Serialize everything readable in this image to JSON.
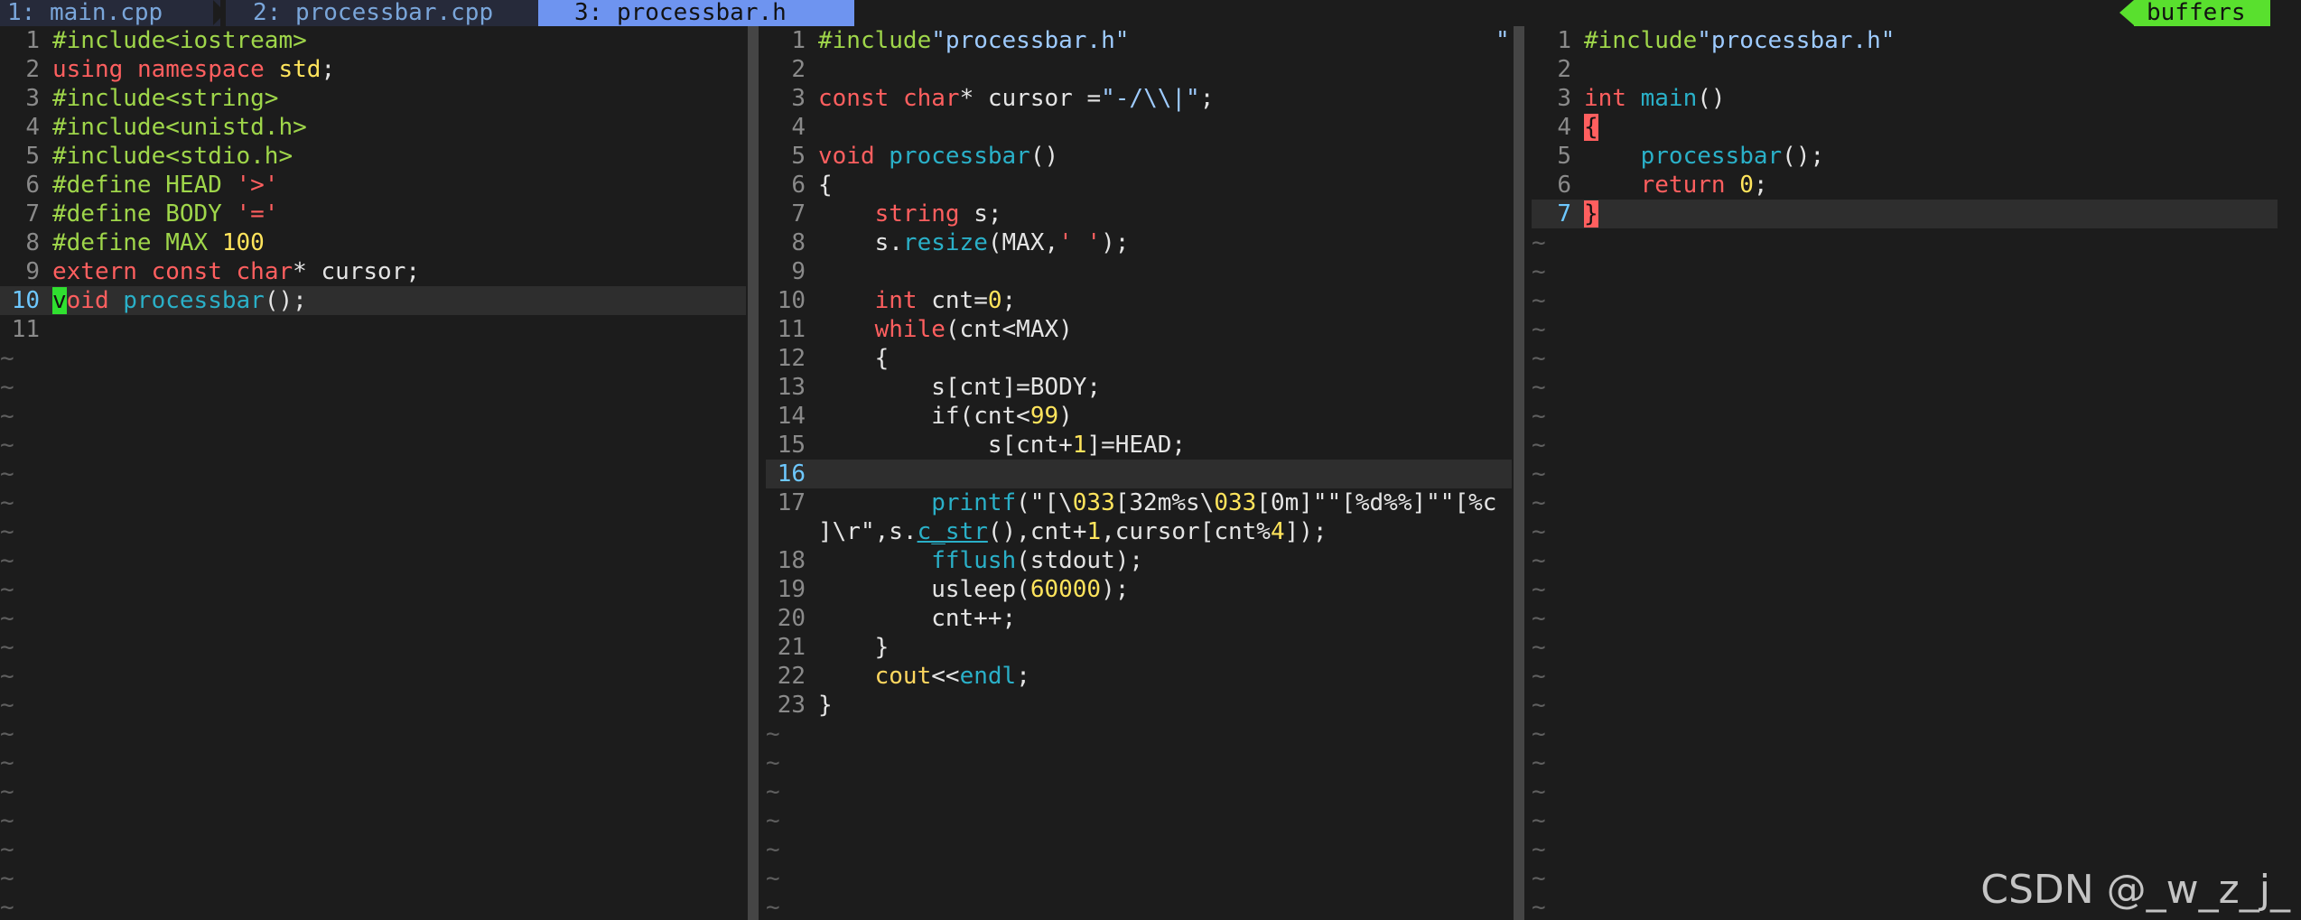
{
  "tabline": {
    "tabs": [
      {
        "label": "1: main.cpp",
        "active": false
      },
      {
        "label": "2: processbar.cpp",
        "active": false
      },
      {
        "label": "3: processbar.h",
        "active": true
      }
    ],
    "buffers_label": "buffers"
  },
  "panes": {
    "left": {
      "lines": [
        {
          "n": "1",
          "html": "<span class='pp'>#include&lt;iostream&gt;</span>"
        },
        {
          "n": "2",
          "html": "<span class='kw'>using</span> <span class='kw'>namespace</span> <span class='nm'>std</span>;"
        },
        {
          "n": "3",
          "html": "<span class='pp'>#include&lt;string&gt;</span>"
        },
        {
          "n": "4",
          "html": "<span class='pp'>#include&lt;unistd.h&gt;</span>"
        },
        {
          "n": "5",
          "html": "<span class='pp'>#include&lt;stdio.h&gt;</span>"
        },
        {
          "n": "6",
          "html": "<span class='pp'>#define HEAD </span><span class='kw'>'&gt;'</span>"
        },
        {
          "n": "7",
          "html": "<span class='pp'>#define BODY </span><span class='kw'>'='</span>"
        },
        {
          "n": "8",
          "html": "<span class='pp'>#define MAX </span><span class='nm'>100</span>"
        },
        {
          "n": "9",
          "html": "<span class='kw'>extern</span> <span class='kw'>const</span> <span class='ty'>char</span>* cursor;"
        },
        {
          "n": "10",
          "html": "<span class='cur-block'>v</span><span class='ty'>oid</span> <span class='fn'>processbar</span>();",
          "current": true
        },
        {
          "n": "11",
          "html": ""
        }
      ],
      "tilde_count": 20
    },
    "middle": {
      "lines": [
        {
          "n": "1",
          "html": "<span class='pp'>#include</span><span class='st'>\"processbar.h\"</span>"
        },
        {
          "n": "2",
          "html": ""
        },
        {
          "n": "3",
          "html": "<span class='kw'>const</span> <span class='ty'>char</span>* cursor =<span class='st'>\"-/\\\\|\"</span>;"
        },
        {
          "n": "4",
          "html": ""
        },
        {
          "n": "5",
          "html": "<span class='ty'>void</span> <span class='fn'>processbar</span>()"
        },
        {
          "n": "6",
          "html": "{"
        },
        {
          "n": "7",
          "html": "    <span class='ty'>string</span> s;"
        },
        {
          "n": "8",
          "html": "    s.<span class='fn'>resize</span>(MAX,<span class='kw'>' '</span>);"
        },
        {
          "n": "9",
          "html": ""
        },
        {
          "n": "10",
          "html": "    <span class='ty'>int</span> cnt=<span class='nm'>0</span>;"
        },
        {
          "n": "11",
          "html": "    <span class='kw'>while</span>(cnt&lt;MAX)"
        },
        {
          "n": "12",
          "html": "    {"
        },
        {
          "n": "13",
          "html": "        s[cnt]=BODY;"
        },
        {
          "n": "14",
          "html": "        <span class='id'>if</span>(cnt&lt;<span class='nm'>99</span>)"
        },
        {
          "n": "15",
          "html": "            s[cnt+<span class='nm'>1</span>]=HEAD;"
        },
        {
          "n": "16",
          "html": "",
          "current": true
        },
        {
          "n": "17",
          "html": "        <span class='fn'>printf</span>(\"[\\<span class='nm'>033</span>[32m%s\\<span class='nm'>033</span>[0m]\"\"[%d%%]\"\"[%c"
        },
        {
          "n": "",
          "html": "]\\r\",s.<span class='fn' style='text-decoration:underline'>c_str</span>(),cnt+<span class='nm'>1</span>,cursor[cnt%<span class='nm'>4</span>]);"
        },
        {
          "n": "18",
          "html": "        <span class='fn'>fflush</span>(stdout);"
        },
        {
          "n": "19",
          "html": "        usleep(<span class='nm'>60000</span>);"
        },
        {
          "n": "20",
          "html": "        cnt++;"
        },
        {
          "n": "21",
          "html": "    }"
        },
        {
          "n": "22",
          "html": "    <span class='hi-y'>cout</span>&lt;&lt;<span class='fn'>endl</span>;"
        },
        {
          "n": "23",
          "html": "}"
        }
      ],
      "tilde_count": 7
    },
    "right": {
      "lines": [
        {
          "n": "1",
          "html": "<span class='pp'>#include</span><span class='st'>\"processbar.h\"</span>"
        },
        {
          "n": "2",
          "html": ""
        },
        {
          "n": "3",
          "html": "<span class='ty'>int</span> <span class='fn'>main</span>()"
        },
        {
          "n": "4",
          "html": "<span class='brace-hl'>{</span>"
        },
        {
          "n": "5",
          "html": "    <span class='fn'>processbar</span>();"
        },
        {
          "n": "6",
          "html": "    <span class='kw'>return</span> <span class='nm'>0</span>;"
        },
        {
          "n": "7",
          "html": "<span class='brace-hl'>}</span>",
          "current": true
        }
      ],
      "tilde_count": 24
    }
  },
  "right_edge_quote": "\"",
  "watermark": "CSDN @_w_z_j_"
}
